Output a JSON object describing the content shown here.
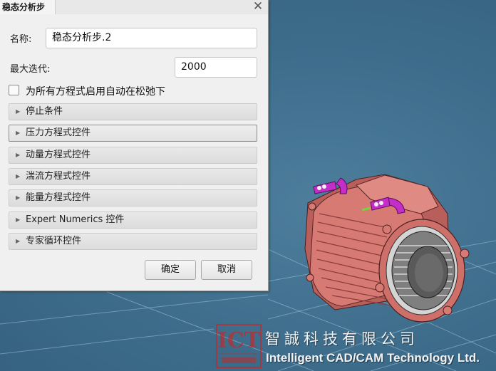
{
  "dialog": {
    "title": "稳态分析步",
    "name_label": "名称:",
    "name_value": "稳态分析步.2",
    "max_iter_label": "最大迭代:",
    "max_iter_value": "2000",
    "auto_relax_label": "为所有方程式启用自动在松弛下",
    "auto_relax_checked": false,
    "sections": [
      {
        "label": "停止条件"
      },
      {
        "label": "压力方程式控件"
      },
      {
        "label": "动量方程式控件"
      },
      {
        "label": "湍流方程式控件"
      },
      {
        "label": "能量方程式控件"
      },
      {
        "label": "Expert Numerics 控件"
      },
      {
        "label": "专家循环控件"
      }
    ],
    "ok_label": "确定",
    "cancel_label": "取消"
  },
  "watermark": {
    "logo_text": "ICT",
    "company_cn": "智誠科技有限公司",
    "company_en": "Intelligent CAD/CAM Technology Ltd."
  },
  "colors": {
    "viewport_background": "#3f6f8e",
    "motor_body": "#d87a74",
    "pipe": "#c42ec8",
    "logo_red": "#c22a2a"
  }
}
